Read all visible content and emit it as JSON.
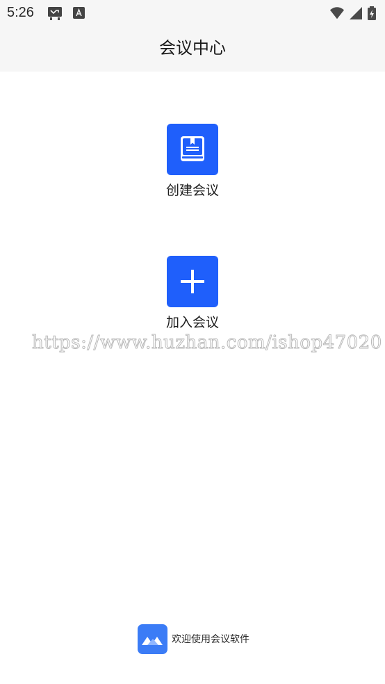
{
  "status_bar": {
    "time": "5:26",
    "left_icons": [
      "missed-call-icon",
      "keyboard-a-icon"
    ],
    "right_icons": [
      "wifi-icon",
      "cellular-signal-icon",
      "battery-charging-icon"
    ]
  },
  "header": {
    "title": "会议中心"
  },
  "actions": [
    {
      "label": "创建会议",
      "icon": "book-icon",
      "color": "#1F5FFB"
    },
    {
      "label": "加入会议",
      "icon": "plus-icon",
      "color": "#1F5FFB"
    }
  ],
  "watermark": {
    "text": "https://www.huzhan.com/ishop47020"
  },
  "footer": {
    "logo": "meeting-app-logo-icon",
    "text": "欢迎使用会议软件",
    "logo_color": "#3B7CF6"
  },
  "colors": {
    "accent": "#1F5FFB",
    "header_bg": "#F6F6F6",
    "page_bg": "#FFFFFF"
  }
}
